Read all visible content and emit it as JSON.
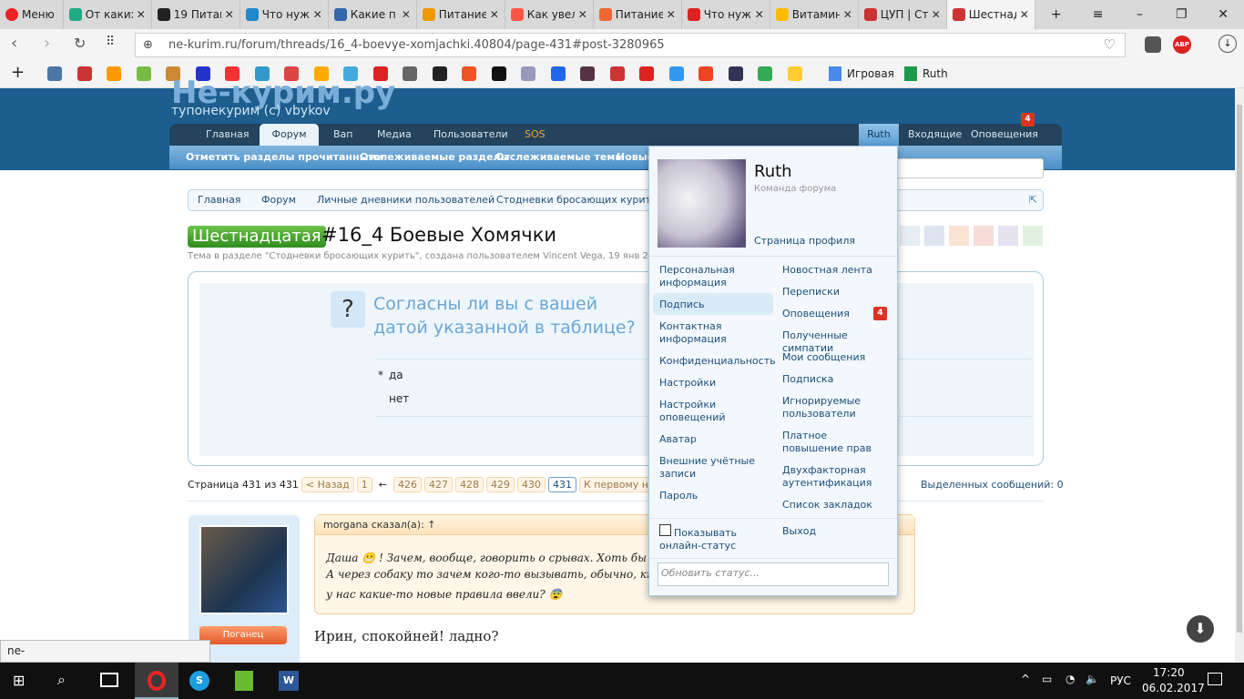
{
  "browser": {
    "menu_label": "Меню",
    "tabs": [
      {
        "title": "От каких",
        "color": "#2a8"
      },
      {
        "title": "19 Питание",
        "color": "#222"
      },
      {
        "title": "Что нужно",
        "color": "#28c"
      },
      {
        "title": "Какие п",
        "color": "#36a"
      },
      {
        "title": "Питание",
        "color": "#e90"
      },
      {
        "title": "Как увел",
        "color": "#f54"
      },
      {
        "title": "Питание",
        "color": "#e63"
      },
      {
        "title": "Что нужно",
        "color": "#d22"
      },
      {
        "title": "Витамин",
        "color": "#fb0"
      },
      {
        "title": "ЦУП | Ст",
        "color": "#c33"
      },
      {
        "title": "Шестнадц",
        "color": "#c33"
      }
    ],
    "url": "ne-kurim.ru/forum/threads/16_4-boevye-xomjachki.40804/page-431#post-3280965",
    "bookmarks": [
      {
        "label": "Игровая"
      },
      {
        "label": "Ruth"
      }
    ],
    "status_url": "ne-kurim.ru/forum/account/signature"
  },
  "site": {
    "logo": "Не-курим.ру",
    "slogan": "тупонекурим (с) vbykov",
    "nav": [
      "Главная",
      "Форум",
      "Вап",
      "Медиа",
      "Пользователи",
      "SOS"
    ],
    "user_nav": [
      "Ruth",
      "Входящие",
      "Оповещения"
    ],
    "alerts_count": "4",
    "subnav": [
      "Отметить разделы прочитанными",
      "Отслеживаемые разделы",
      "Отслеживаемые темы",
      "Новые"
    ],
    "breadcrumbs": [
      "Главная",
      "Форум",
      "Личные дневники пользователей",
      "Стодневки бросающих курить"
    ]
  },
  "thread": {
    "prefix": "Шестнадцатая",
    "title": "#16_4 Боевые Хомячки",
    "meta": "Тема в разделе \"Стодневки бросающих курить\", создана пользователем Vincent Vega, 19 янв 2017.",
    "poll_question": "Согласны ли вы с вашей датой указанной в таблице?",
    "poll_options": [
      {
        "mark": "*",
        "label": "да"
      },
      {
        "mark": "",
        "label": "нет"
      }
    ]
  },
  "pager": {
    "label": "Страница 431 из 431",
    "prev": "< Назад",
    "first": "1",
    "arrow": "←",
    "pages": [
      "426",
      "427",
      "428",
      "429",
      "430",
      "431"
    ],
    "current": "431",
    "unread": "К первому непрочитанному",
    "selected": "Выделенных сообщений: 0"
  },
  "post": {
    "quote_author": "morgana сказал(а): ↑",
    "quote_lines": [
      "Даша 😬 ! Зачем, вообще, говорить о срывах. Хоть бы ТТТ",
      "А через собаку то зачем кого-то вызывать, обычно, кто пере",
      "у нас какие-то новые правила ввели? 😨"
    ],
    "reply": "Ирин, спокойней! ладно?",
    "user_title": "Поганец"
  },
  "dropdown": {
    "name": "Ruth",
    "role": "Команда форума",
    "profile": "Страница профиля",
    "left": [
      "Персональная информация",
      "Подпись",
      "Контактная информация",
      "Конфиденциальность",
      "Настройки",
      "Настройки оповещений",
      "Аватар",
      "Внешние учётные записи",
      "Пароль"
    ],
    "right": [
      "Новостная лента",
      "Переписки",
      "Оповещения",
      "Полученные симпатии",
      "Мои сообщения",
      "Подписка",
      "Игнорируемые пользователи",
      "Платное повышение прав",
      "Двухфакторная аутентификация",
      "Список закладок"
    ],
    "alerts_count": "4",
    "online_status": "Показывать онлайн-статус",
    "logout": "Выход",
    "status_placeholder": "Обновить статус..."
  },
  "taskbar": {
    "lang": "РУС",
    "time": "17:20",
    "date": "06.02.2017"
  }
}
